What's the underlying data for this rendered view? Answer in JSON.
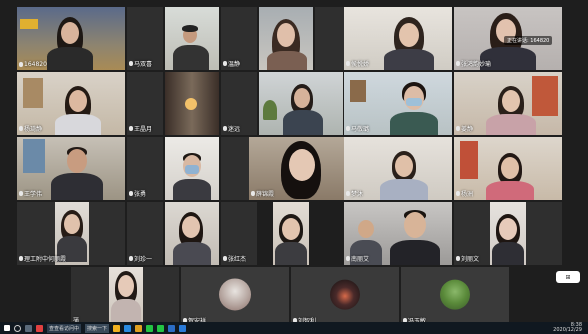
{
  "meeting": {
    "meeting_id_label": "164820",
    "speaking_label": "正在讲话: 164820"
  },
  "participants": [
    {
      "name": "164820"
    },
    {
      "name": "马双喜"
    },
    {
      "name": ""
    },
    {
      "name": "温静"
    },
    {
      "name": "侯悦娇"
    },
    {
      "name": "张鸿韵妙瑜"
    },
    {
      "name": "杨琦静"
    },
    {
      "name": "王晶月"
    },
    {
      "name": ""
    },
    {
      "name": "迷远"
    },
    {
      "name": "马敬璐"
    },
    {
      "name": "姜静"
    },
    {
      "name": "王学伟"
    },
    {
      "name": "张勇"
    },
    {
      "name": ""
    },
    {
      "name": "薛锦霞"
    },
    {
      "name": "梦沐"
    },
    {
      "name": "杨洲"
    },
    {
      "name": "理工附中何丽霞"
    },
    {
      "name": "刘珍一"
    },
    {
      "name": ""
    },
    {
      "name": "张红杰"
    },
    {
      "name": "南丽艾"
    },
    {
      "name": "刘丽文"
    },
    {
      "name": "薄"
    },
    {
      "name": "贺安祥"
    },
    {
      "name": "刘智利"
    },
    {
      "name": "冯玉敏"
    }
  ],
  "float_panel": {
    "label": "⊞"
  },
  "taskbar": {
    "search_label": "搜索一下",
    "app1_label": "查查看访问中",
    "time": "8:38",
    "date": "2020/12/29"
  },
  "colors": {
    "accent_green": "#23c343",
    "taskbar": "#101820"
  }
}
